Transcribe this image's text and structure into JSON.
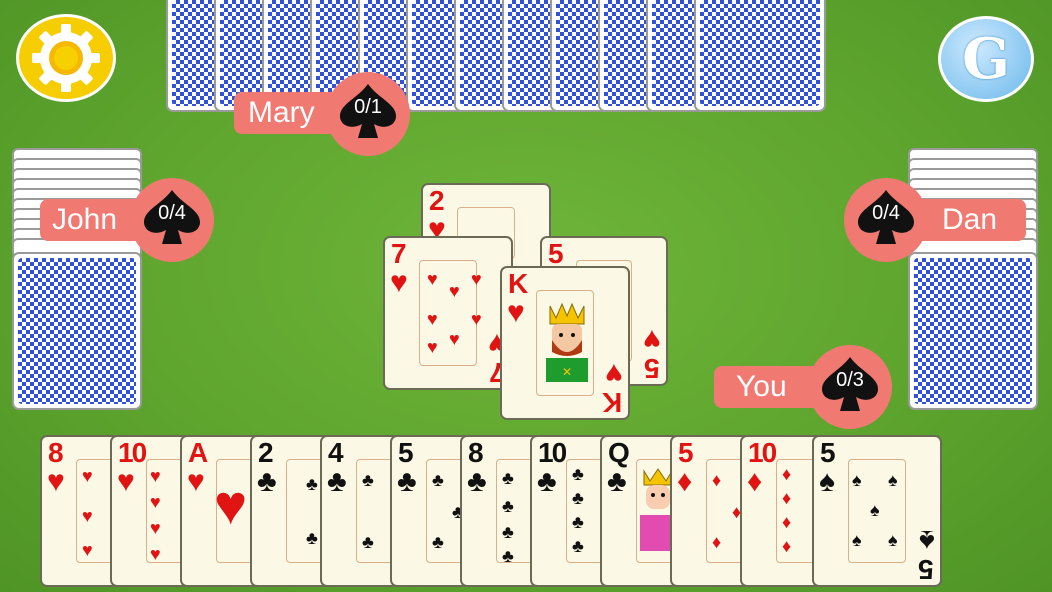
{
  "players": {
    "top": {
      "name": "Mary",
      "score": "0/1"
    },
    "left": {
      "name": "John",
      "score": "0/4"
    },
    "right": {
      "name": "Dan",
      "score": "0/4"
    },
    "bottom": {
      "name": "You",
      "score": "0/3"
    }
  },
  "trick": [
    {
      "rank": "2",
      "suit": "♥",
      "color": "red"
    },
    {
      "rank": "7",
      "suit": "♥",
      "color": "red"
    },
    {
      "rank": "5",
      "suit": "♥",
      "color": "red"
    },
    {
      "rank": "K",
      "suit": "♥",
      "color": "red"
    }
  ],
  "hand": [
    {
      "rank": "8",
      "suit": "♥",
      "color": "red"
    },
    {
      "rank": "10",
      "suit": "♥",
      "color": "red"
    },
    {
      "rank": "A",
      "suit": "♥",
      "color": "red"
    },
    {
      "rank": "2",
      "suit": "♣",
      "color": "black"
    },
    {
      "rank": "4",
      "suit": "♣",
      "color": "black"
    },
    {
      "rank": "5",
      "suit": "♣",
      "color": "black"
    },
    {
      "rank": "8",
      "suit": "♣",
      "color": "black"
    },
    {
      "rank": "10",
      "suit": "♣",
      "color": "black"
    },
    {
      "rank": "Q",
      "suit": "♣",
      "color": "black"
    },
    {
      "rank": "5",
      "suit": "♦",
      "color": "red"
    },
    {
      "rank": "10",
      "suit": "♦",
      "color": "red"
    },
    {
      "rank": "5",
      "suit": "♠",
      "color": "black"
    }
  ],
  "buttons": {
    "settings_icon": "gear-icon",
    "games_label": "G"
  },
  "colors": {
    "felt": "#5ea52e",
    "tag": "#f07a72",
    "card_back": "#1c3fd6",
    "card_face": "#fbf8e6"
  }
}
